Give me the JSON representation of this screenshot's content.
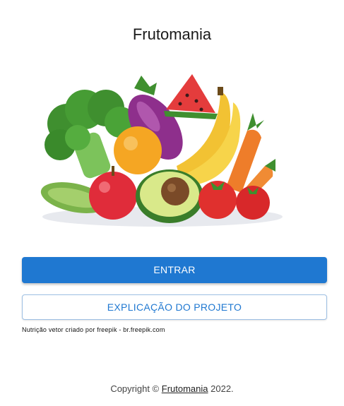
{
  "header": {
    "title": "Frutomania"
  },
  "hero": {
    "image_name": "fruits-vegetables-illustration"
  },
  "actions": {
    "enter_label": "ENTRAR",
    "explain_label": "EXPLICAÇÃO DO PROJETO"
  },
  "credit": {
    "text": "Nutrição vetor criado por freepik - br.freepik.com"
  },
  "footer": {
    "prefix": "Copyright ©",
    "link": "Frutomania",
    "suffix": "2022."
  },
  "colors": {
    "primary": "#1f78d1",
    "outline_border": "#9dbfe3"
  }
}
